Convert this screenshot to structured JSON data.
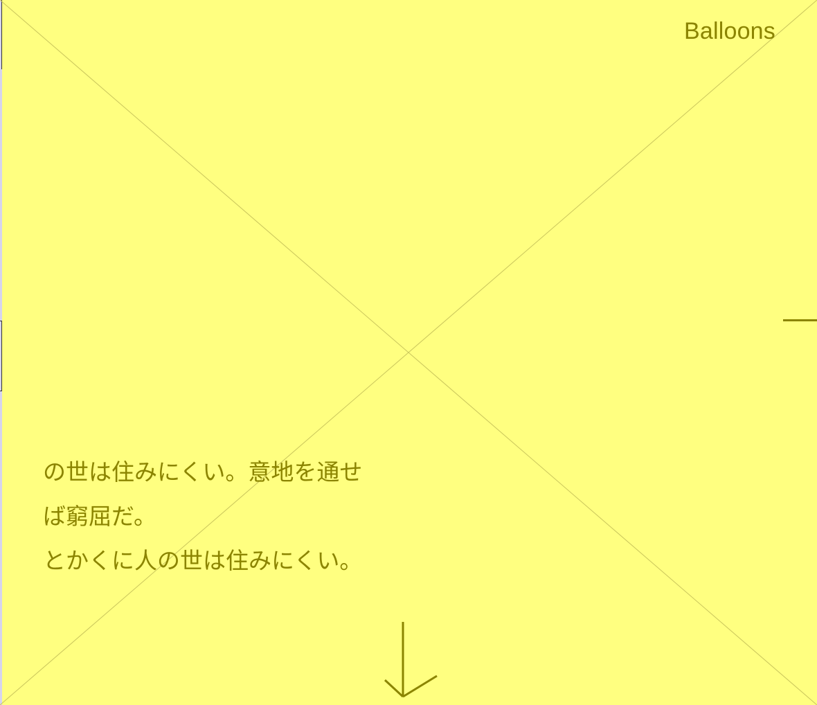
{
  "header": {
    "brand": "Balloons"
  },
  "hero": {
    "lines": [
      "の世は住みにくい。意地を通せ",
      "ば窮屈だ。",
      "とかくに人の世は住みにくい。"
    ]
  },
  "controls": {
    "scroll_down_icon": "down-arrow-icon",
    "side_indicator_icon": "dash-icon"
  },
  "colors": {
    "background": "#ffff80",
    "accent": "#8b8400",
    "placeholder_cross": "#c9c55c"
  }
}
